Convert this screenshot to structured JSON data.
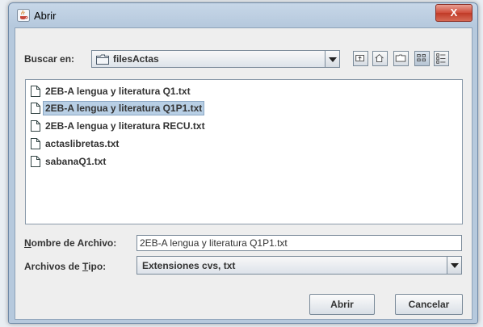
{
  "window": {
    "title": "Abrir",
    "close_label": "X"
  },
  "lookin": {
    "label": "Buscar en:",
    "value": "filesActas"
  },
  "toolbar": {
    "icons": [
      "up-one-level-icon",
      "home-icon",
      "new-folder-icon",
      "list-view-icon",
      "details-view-icon"
    ]
  },
  "files": [
    {
      "name": "2EB-A lengua y literatura Q1.txt",
      "selected": false
    },
    {
      "name": "2EB-A lengua y literatura Q1P1.txt",
      "selected": true
    },
    {
      "name": "2EB-A lengua y literatura RECU.txt",
      "selected": false
    },
    {
      "name": "actaslibretas.txt",
      "selected": false
    },
    {
      "name": "sabanaQ1.txt",
      "selected": false
    }
  ],
  "filename": {
    "label": "Nombre de Archivo:",
    "value": "2EB-A lengua y literatura Q1P1.txt"
  },
  "filetype": {
    "label": "Archivos de Tipo:",
    "value": "Extensiones cvs, txt"
  },
  "buttons": {
    "open": "Abrir",
    "cancel": "Cancelar"
  }
}
